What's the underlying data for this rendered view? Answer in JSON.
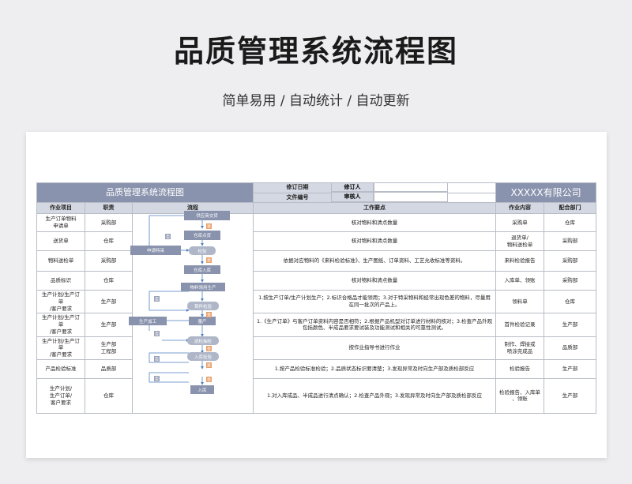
{
  "page": {
    "title": "品质管理系统流程图",
    "subtitle": "简单易用 / 自动统计 / 自动更新"
  },
  "sheet": {
    "title": "品质管理系统流程图",
    "revise_date_label": "修订日期",
    "doc_no_label": "文件编号",
    "reviser_label": "修订人",
    "approver_label": "审核人",
    "company": "XXXXX有限公司",
    "columns": [
      "作业项目",
      "职责",
      "流程",
      "工作要点",
      "作业内容",
      "配合部门"
    ],
    "rows": [
      {
        "item": "生产订单物料\n申请单",
        "duty": "采购部",
        "req": "核对物料和清点数量",
        "content": "采购单",
        "dept": "仓库"
      },
      {
        "item": "送货单",
        "duty": "仓库",
        "req": "核对物料和清点数量",
        "content": "退货单/\n物料送检单",
        "dept": "采购部"
      },
      {
        "item": "物料送检单",
        "duty": "采购部",
        "req": "依据对应物料的《来料检验标准》、生产图纸、订单资料、工艺允收标准等资料。",
        "content": "来料检验报告",
        "dept": "采购部"
      },
      {
        "item": "品质标识",
        "duty": "仓库",
        "req": "核对物料和清点数量",
        "content": "入库单、领账",
        "dept": "采购部"
      },
      {
        "item": "生产计划/生产订单\n/客户要求",
        "duty": "生产部",
        "req": "1.按生产订单/生产计划生产；2.标识合格品才能领用；3.对于特采物料和经常出现色差的物料，尽量用在同一批次的产品上。",
        "content": "领料单",
        "dept": "仓库"
      },
      {
        "item": "生产计划/生产订单\n/客户要求",
        "duty": "生产部",
        "req": "1.《生产订单》与客户订单资料内容是否相符；2.根据产品机型对订单进行材料的核对；3.检查产品外观包括颜色、半成品要求要试装及功能测试和相关的可靠性测试。",
        "content": "首件检验记录",
        "dept": "生产部"
      },
      {
        "item": "生产计划/生产订单\n/客户要求",
        "duty": "生产部\n工程部",
        "req": "按作业指导书进行作业",
        "content": "制作、焊接或\n喷涂完成品",
        "dept": "品质部"
      },
      {
        "item": "产品检验标准",
        "duty": "品质部",
        "req": "1.按产品检验标准检验；2.品质状态标识要清楚；3.发现异常及时向生产部及质检部反应",
        "content": "检验报告",
        "dept": "生产部"
      },
      {
        "item": "生产计划/\n生产订单/\n客户要求",
        "duty": "仓库",
        "req": "1.对入库成品、半成品进行清点确认；2.检查产品外观；3.发现异常及时向生产部及质检部反应",
        "content": "检验报告、入库单\n、领账",
        "dept": "生产部"
      }
    ]
  },
  "flow": {
    "nodes": [
      "供应商交货",
      "仓库点货",
      "申请特采",
      "检验",
      "仓库入库",
      "物料领用生产",
      "首件检验",
      "生产加工",
      "量产",
      "巡检抽检",
      "入库检验",
      "入库"
    ],
    "yes": "是",
    "no": "否"
  },
  "colors": {
    "header_fill": "#8993ad",
    "label_fill": "#d4d8e2",
    "node_fill": "#8993ad",
    "node_light": "#aeb6c8",
    "yes_fill": "#e8a06a",
    "no_fill": "#9aa3b8",
    "arrow": "#4e7fc0"
  }
}
